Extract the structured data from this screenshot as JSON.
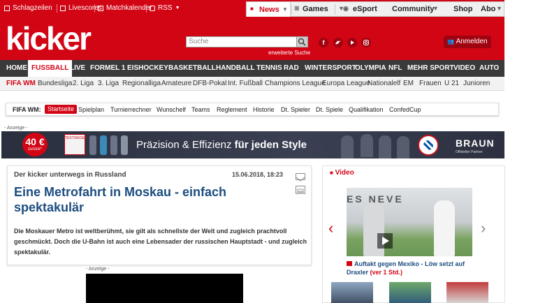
{
  "topbar": {
    "items": [
      "Schlagzeilen",
      "Livescores",
      "Matchkalender",
      "RSS"
    ],
    "right": [
      "News",
      "Games",
      "eSport",
      "Community",
      "Shop",
      "Abo"
    ]
  },
  "header": {
    "logo": "kicker",
    "search_placeholder": "Suche",
    "advanced_search": "erweiterte Suche",
    "login": "Anmelden",
    "social": [
      "f",
      "t",
      "ig"
    ]
  },
  "mainnav": [
    "HOME",
    "FUSSBALL",
    "LIVE",
    "FORMEL 1",
    "EISHOCKEY",
    "BASKETBALL",
    "HANDBALL",
    "TENNIS",
    "RAD",
    "WINTERSPORT",
    "OLYMPIA",
    "NFL",
    "MEHR SPORT",
    "VIDEO",
    "AUTO"
  ],
  "subnav": [
    "FIFA WM",
    "Bundesliga",
    "2. Liga",
    "3. Liga",
    "Regionalliga",
    "Amateure",
    "DFB-Pokal",
    "Int. Fußball",
    "Champions League",
    "Europa League",
    "Nationalelf",
    "EM",
    "Frauen",
    "U 21",
    "Junioren"
  ],
  "wmbar": {
    "label": "FIFA WM:",
    "items": [
      "Startseite",
      "Spielplan",
      "Turnierrechner",
      "Wunschelf",
      "Teams",
      "Reglement",
      "Historie",
      "Dt. Spieler",
      "Dt. Spiele",
      "Qualifikation",
      "ConfedCup"
    ]
  },
  "ad": {
    "label": "- Anzeige -",
    "badge_value": "40 €",
    "badge_sub": "zurück*",
    "test_label": "TESTSIEGER",
    "text_regular": "Präzision & Effizienz ",
    "text_bold": "für jeden Style",
    "brand": "BRAUN",
    "brand_sub": "Offizieller Partner"
  },
  "article": {
    "kicker": "Der kicker unterwegs in Russland",
    "date": "15.06.2018, 18:23",
    "headline": "Eine Metrofahrt in Moskau - einfach spektakulär",
    "teaser": "Die Moskauer Metro ist weltberühmt, sie gilt als schnellste der Welt und zugleich prachtvoll geschmückt. Doch die U-Bahn ist auch eine Lebensader der russischen Hauptstadt - und zugleich spektakulär."
  },
  "ad2": {
    "label": "- Anzeige -"
  },
  "video": {
    "header": "Video",
    "wall_text": "ES NEVE",
    "caption_main": "Auftakt gegen Mexiko - Löw setzt auf Draxler ",
    "caption_count": "(ver 1 Std.)"
  }
}
